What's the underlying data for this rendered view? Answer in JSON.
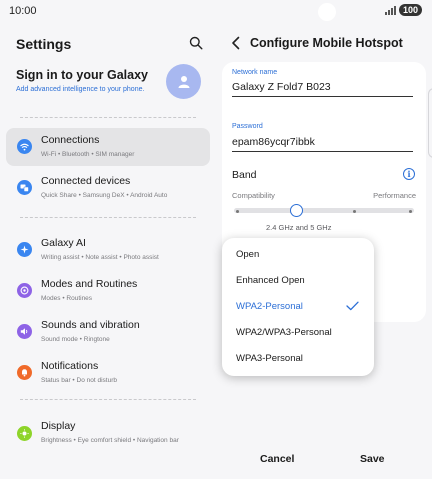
{
  "status": {
    "time": "10:00",
    "battery": "100"
  },
  "left": {
    "title": "Settings",
    "account": {
      "title": "Sign in to your Galaxy",
      "subtitle": "Add advanced intelligence to your phone."
    },
    "items": [
      {
        "title": "Connections",
        "subtitle": "Wi-Fi  •  Bluetooth  •  SIM manager",
        "icon": "wifi-icon",
        "color": "#3a86f0"
      },
      {
        "title": "Connected devices",
        "subtitle": "Quick Share  •  Samsung DeX  •  Android Auto",
        "icon": "devices-icon",
        "color": "#3a86f0"
      },
      {
        "title": "Galaxy AI",
        "subtitle": "Writing assist  •  Note assist  •  Photo assist",
        "icon": "sparkle-icon",
        "color": "#3a86f0"
      },
      {
        "title": "Modes and Routines",
        "subtitle": "Modes  •  Routines",
        "icon": "modes-icon",
        "color": "#8e63e6"
      },
      {
        "title": "Sounds and vibration",
        "subtitle": "Sound mode  •  Ringtone",
        "icon": "sound-icon",
        "color": "#8e63e6"
      },
      {
        "title": "Notifications",
        "subtitle": "Status bar  •  Do not disturb",
        "icon": "notification-icon",
        "color": "#f06a2a"
      },
      {
        "title": "Display",
        "subtitle": "Brightness  •  Eye comfort shield  •  Navigation bar",
        "icon": "display-icon",
        "color": "#8ed42a"
      }
    ]
  },
  "right": {
    "title": "Configure Mobile Hotspot",
    "network_name_label": "Network name",
    "network_name": "Galaxy Z Fold7 B023",
    "password_label": "Password",
    "password": "epam86ycqr7ibbk",
    "band_label": "Band",
    "compatibility_label": "Compatibility",
    "performance_label": "Performance",
    "band_value": "2.4 GHz and 5 GHz",
    "cancel_label": "Cancel",
    "save_label": "Save"
  },
  "dropdown": {
    "options": [
      "Open",
      "Enhanced Open",
      "WPA2-Personal",
      "WPA2/WPA3-Personal",
      "WPA3-Personal"
    ],
    "selected": "WPA2-Personal"
  },
  "colors": {
    "accent": "#2c6fd6",
    "selected_row": "#e4e4e6"
  }
}
